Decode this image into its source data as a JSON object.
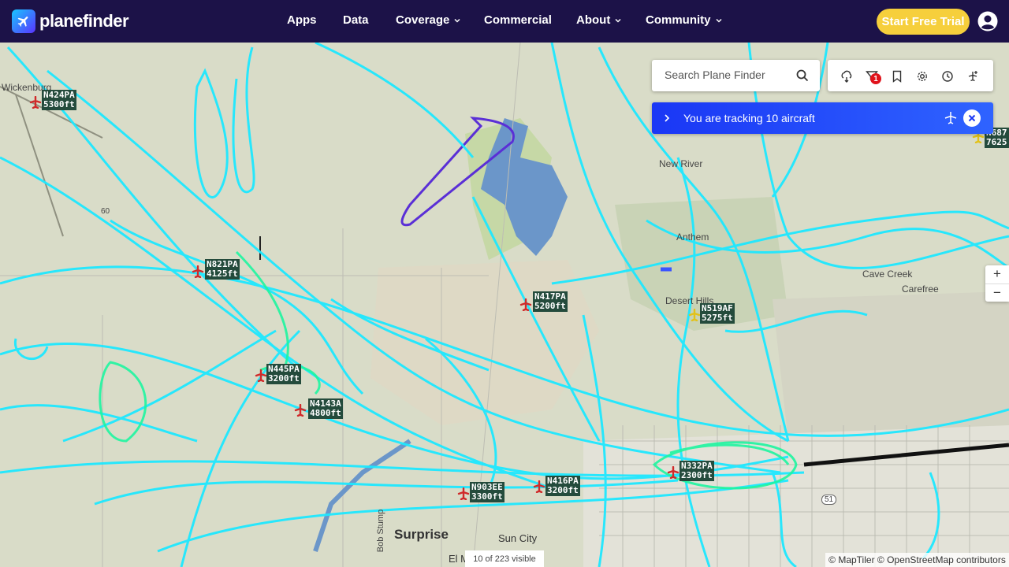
{
  "brand": {
    "name": "planefinder"
  },
  "nav": {
    "items": [
      {
        "label": "Apps",
        "dropdown": false
      },
      {
        "label": "Data",
        "dropdown": false
      },
      {
        "label": "Coverage",
        "dropdown": true
      },
      {
        "label": "Commercial",
        "dropdown": false
      },
      {
        "label": "About",
        "dropdown": true
      },
      {
        "label": "Community",
        "dropdown": true
      }
    ],
    "trial_button": "Start Free Trial",
    "user_icon": "user-circle-icon"
  },
  "search": {
    "placeholder": "Search Plane Finder"
  },
  "toolbar": {
    "icons": [
      "weather-icon",
      "filter-icon",
      "bookmark-icon",
      "settings-icon",
      "history-icon",
      "add-aircraft-icon"
    ],
    "filter_badge": "1"
  },
  "tracking": {
    "text": "You are tracking 10 aircraft"
  },
  "zoom": {
    "in": "+",
    "out": "−"
  },
  "aircraft": [
    {
      "callsign": "N424PA",
      "altitude": "5300ft",
      "color": "#d02a2a"
    },
    {
      "callsign": "N821PA",
      "altitude": "4125ft",
      "color": "#d02a2a"
    },
    {
      "callsign": "N417PA",
      "altitude": "5200ft",
      "color": "#d02a2a"
    },
    {
      "callsign": "N519AF",
      "altitude": "5275ft",
      "color": "#e2c21a"
    },
    {
      "callsign": "N445PA",
      "altitude": "3200ft",
      "color": "#d02a2a"
    },
    {
      "callsign": "N4143A",
      "altitude": "4800ft",
      "color": "#d02a2a"
    },
    {
      "callsign": "N332PA",
      "altitude": "2300ft",
      "color": "#d02a2a"
    },
    {
      "callsign": "N903EE",
      "altitude": "3300ft",
      "color": "#d02a2a"
    },
    {
      "callsign": "N416PA",
      "altitude": "3200ft",
      "color": "#d02a2a"
    },
    {
      "callsign": "N687",
      "altitude": "7625",
      "color": "#e2c21a"
    }
  ],
  "places": [
    "Wickenburg",
    "New River",
    "Anthem",
    "Cave Creek",
    "Carefree",
    "Desert Hills",
    "Surprise",
    "Sun City",
    "El M",
    "Bob Stump",
    "51",
    "60"
  ],
  "footer": {
    "visible_count": "10 of 223 visible",
    "attribution": "© MapTiler © OpenStreetMap contributors"
  },
  "colors": {
    "nav_bg": "#1c1248",
    "trial_bg": "#f6cf3c",
    "track_bar": "#1a37f5",
    "track_cyan": "#1ee8ff",
    "track_green": "#1ef5a0"
  }
}
